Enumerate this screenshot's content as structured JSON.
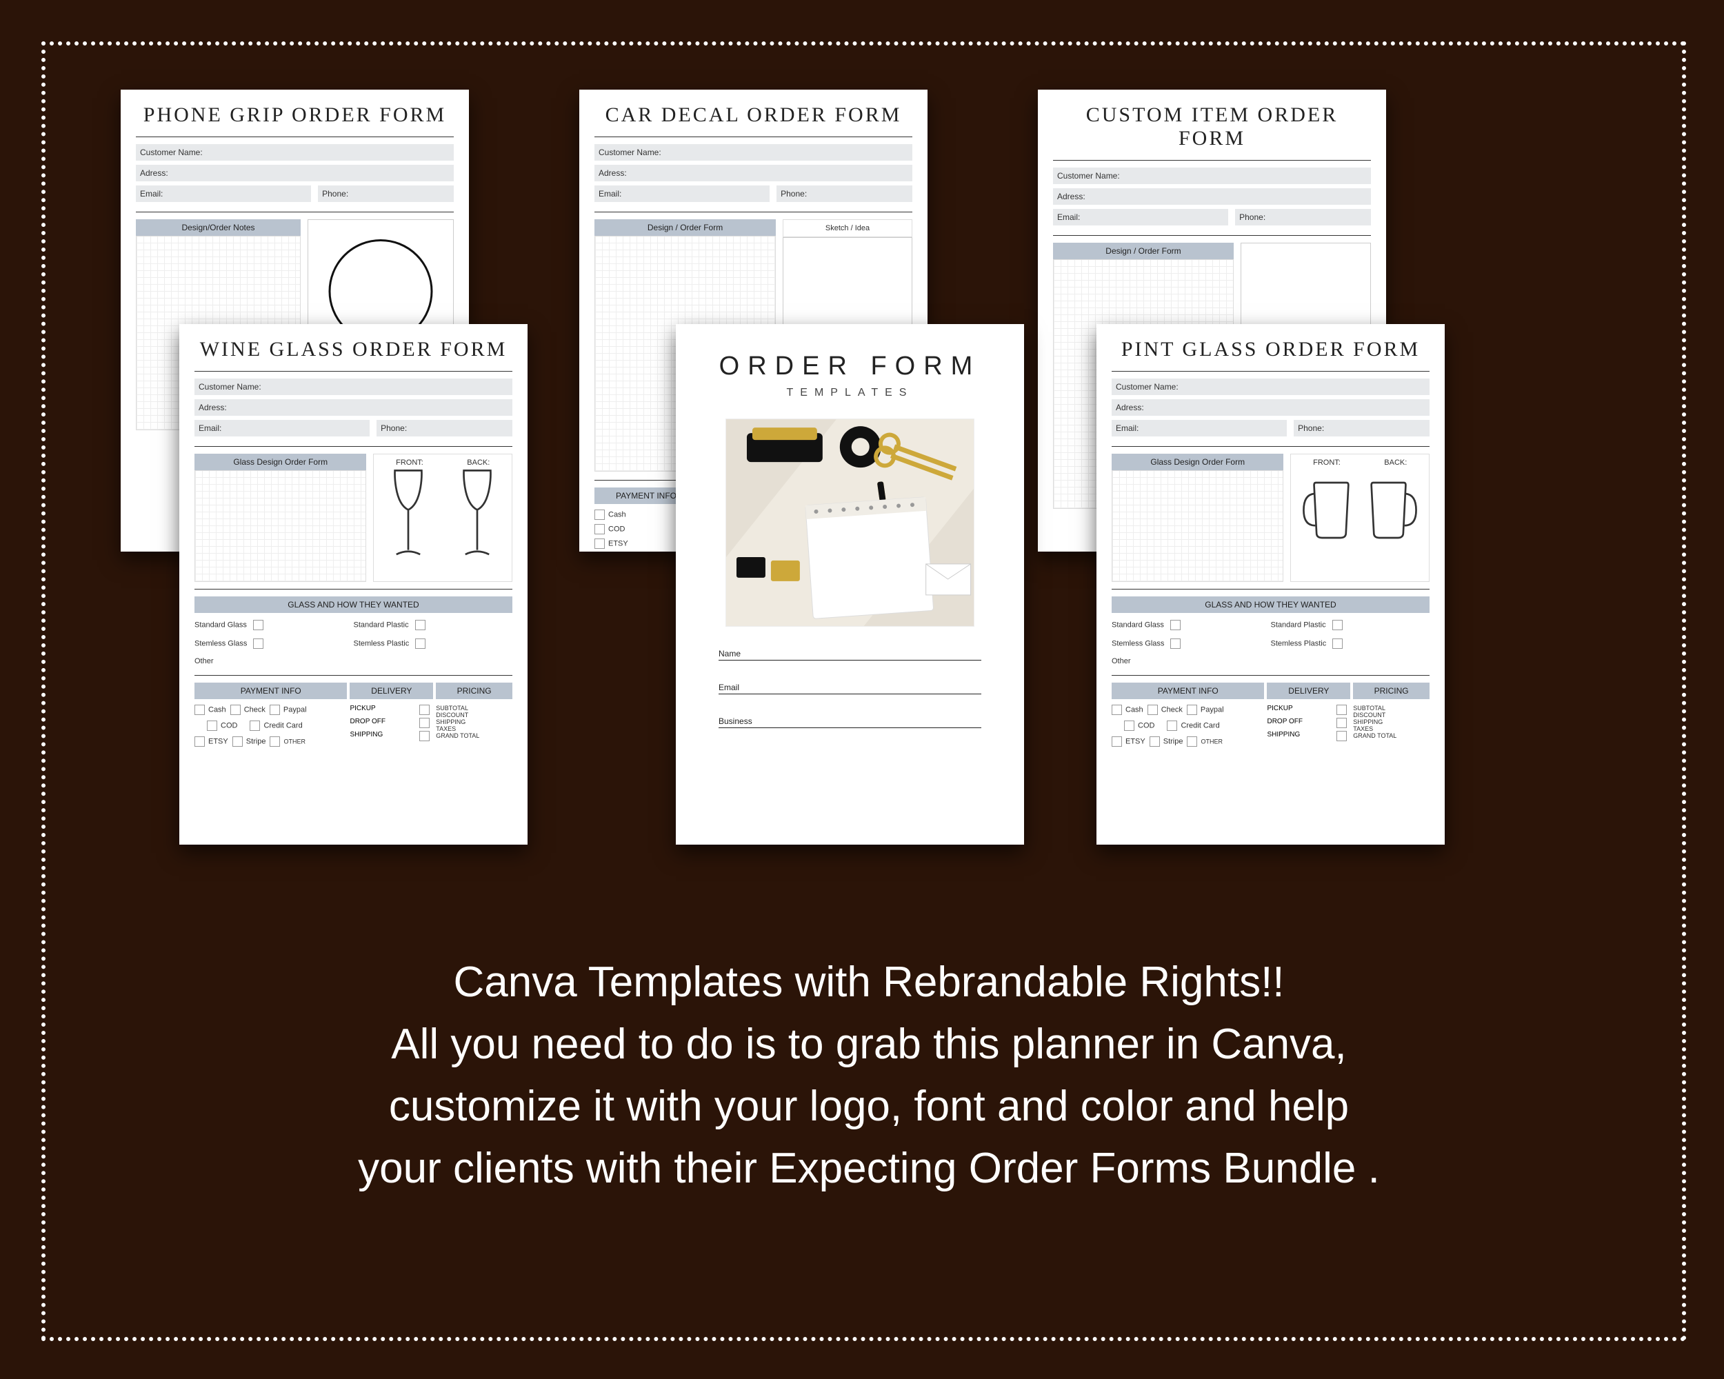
{
  "marketing": {
    "line1": "Canva Templates with Rebrandable Rights!!",
    "line2": "All you need to do is to grab this planner in Canva,",
    "line3": "customize it with your logo, font and color and help",
    "line4": "your clients with their Expecting Order Forms Bundle  ."
  },
  "forms": {
    "phoneGrip": {
      "title": "PHONE GRIP ORDER FORM",
      "customer": "Customer Name:",
      "address": "Adress:",
      "email": "Email:",
      "phone": "Phone:",
      "designHeader": "Design/Order Notes"
    },
    "carDecal": {
      "title": "CAR DECAL ORDER FORM",
      "customer": "Customer Name:",
      "address": "Adress:",
      "email": "Email:",
      "phone": "Phone:",
      "designHeader": "Design / Order Form",
      "sketch": "Sketch / Idea",
      "payment": "PAYMENT INFO",
      "cash": "Cash",
      "cod": "COD",
      "etsy": "ETSY"
    },
    "customItem": {
      "title": "CUSTOM ITEM ORDER FORM",
      "customer": "Customer Name:",
      "address": "Adress:",
      "email": "Email:",
      "phone": "Phone:",
      "designHeader": "Design / Order Form"
    },
    "wineGlass": {
      "title": "WINE GLASS ORDER FORM",
      "customer": "Customer Name:",
      "address": "Adress:",
      "email": "Email:",
      "phone": "Phone:",
      "designHeader": "Glass Design Order Form",
      "front": "FRONT:",
      "back": "BACK:",
      "glassHow": "GLASS AND HOW THEY WANTED",
      "stdGlass": "Standard Glass",
      "stdPlastic": "Standard Plastic",
      "stemlessGlass": "Stemless Glass",
      "stemlessPlastic": "Stemless Plastic",
      "other": "Other",
      "paymentHdr": "PAYMENT INFO",
      "deliveryHdr": "DELIVERY",
      "pricingHdr": "PRICING",
      "cash": "Cash",
      "check": "Check",
      "paypal": "Paypal",
      "cod": "COD",
      "credit": "Credit Card",
      "etsy": "ETSY",
      "stripe": "Stripe",
      "otherPay": "OTHER",
      "pickup": "PICKUP",
      "dropoff": "DROP OFF",
      "shipping": "SHIPPING",
      "subtotal": "SUBTOTAL",
      "discount": "DISCOUNT",
      "shipPrice": "SHIPPING",
      "taxes": "TAXES",
      "grand": "GRAND  TOTAL"
    },
    "pintGlass": {
      "title": "PINT GLASS ORDER FORM",
      "customer": "Customer Name:",
      "address": "Adress:",
      "email": "Email:",
      "phone": "Phone:",
      "designHeader": "Glass Design Order Form",
      "front": "FRONT:",
      "back": "BACK:",
      "glassHow": "GLASS AND HOW THEY WANTED",
      "stdGlass": "Standard Glass",
      "stdPlastic": "Standard Plastic",
      "stemlessGlass": "Stemless Glass",
      "stemlessPlastic": "Stemless Plastic",
      "other": "Other",
      "paymentHdr": "PAYMENT INFO",
      "deliveryHdr": "DELIVERY",
      "pricingHdr": "PRICING",
      "cash": "Cash",
      "check": "Check",
      "paypal": "Paypal",
      "cod": "COD",
      "credit": "Credit Card",
      "etsy": "ETSY",
      "stripe": "Stripe",
      "otherPay": "OTHER",
      "pickup": "PICKUP",
      "dropoff": "DROP OFF",
      "shipping": "SHIPPING",
      "subtotal": "SUBTOTAL",
      "discount": "DISCOUNT",
      "shipPrice": "SHIPPING",
      "taxes": "TAXES",
      "grand": "GRAND  TOTAL"
    }
  },
  "cover": {
    "title": "ORDER FORM",
    "subtitle": "TEMPLATES",
    "name": "Name",
    "email": "Email",
    "business": "Business"
  }
}
